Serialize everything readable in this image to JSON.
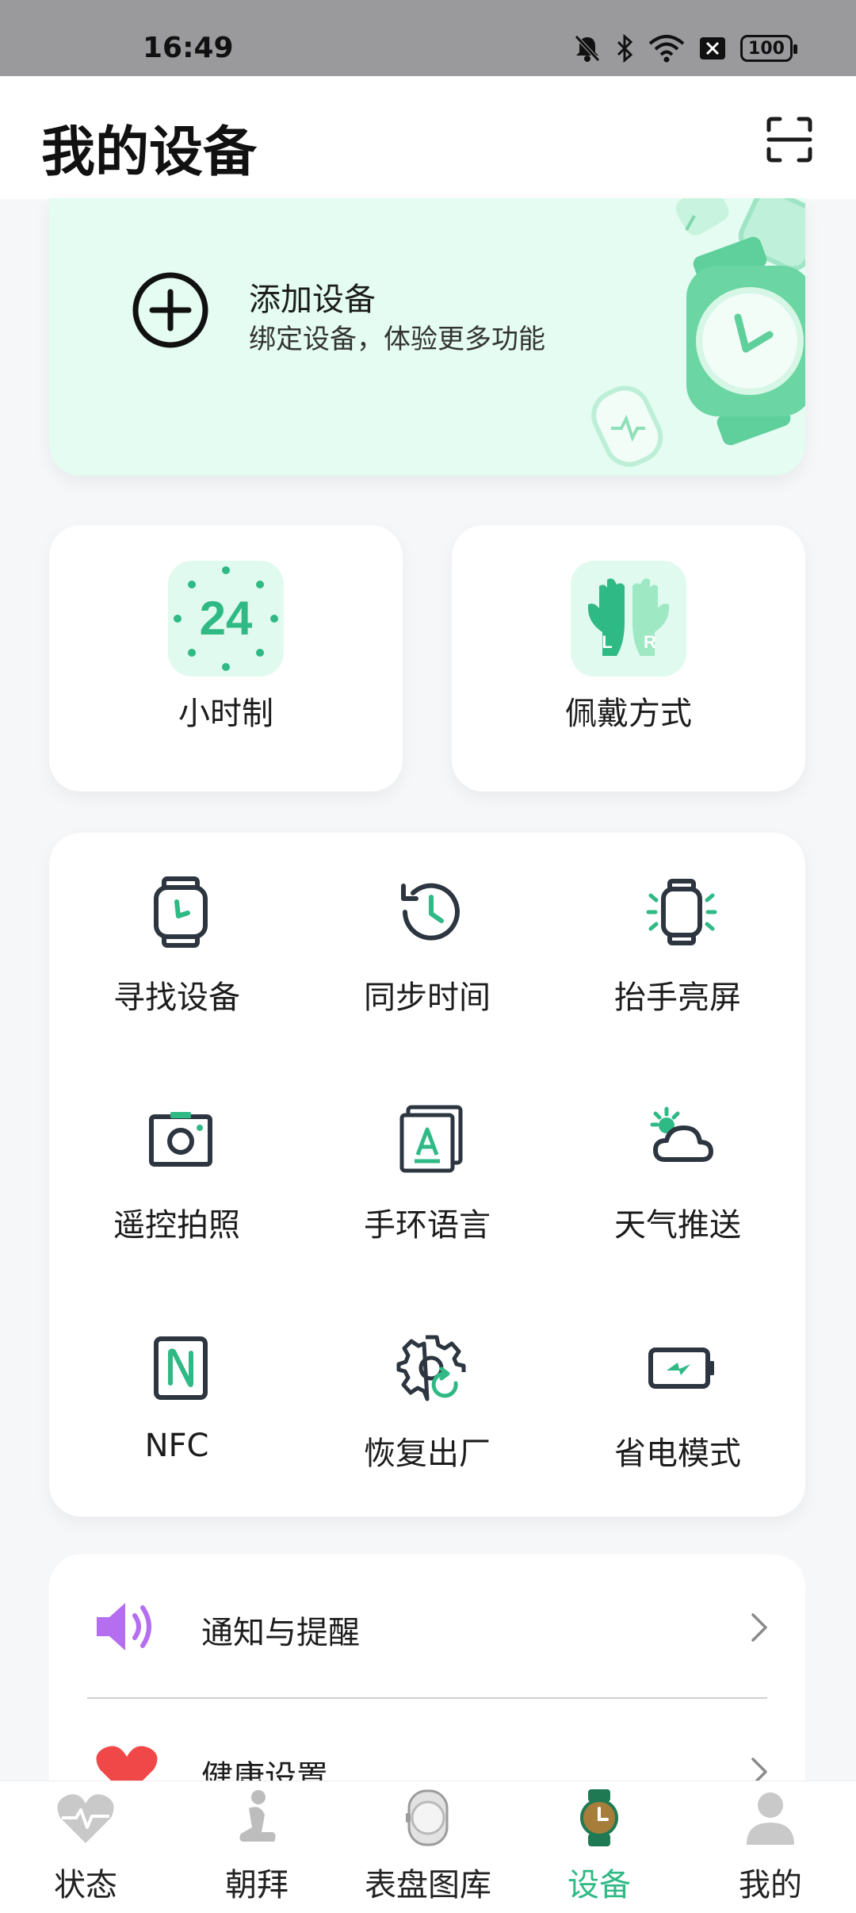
{
  "status_bar": {
    "time": "16:49",
    "battery": "100"
  },
  "header": {
    "title": "我的设备"
  },
  "add_device": {
    "title": "添加设备",
    "subtitle": "绑定设备，体验更多功能"
  },
  "quick_cards": [
    {
      "label": "小时制",
      "badge_text": "24"
    },
    {
      "label": "佩戴方式",
      "badge_left": "L",
      "badge_right": "R"
    }
  ],
  "features": [
    {
      "label": "寻找设备",
      "icon": "watch-find-icon"
    },
    {
      "label": "同步时间",
      "icon": "clock-sync-icon"
    },
    {
      "label": "抬手亮屏",
      "icon": "watch-wake-icon"
    },
    {
      "label": "遥控拍照",
      "icon": "camera-icon"
    },
    {
      "label": "手环语言",
      "icon": "language-icon"
    },
    {
      "label": "天气推送",
      "icon": "weather-icon"
    },
    {
      "label": "NFC",
      "icon": "nfc-icon"
    },
    {
      "label": "恢复出厂",
      "icon": "factory-reset-icon"
    },
    {
      "label": "省电模式",
      "icon": "battery-saver-icon"
    }
  ],
  "settings_list": [
    {
      "label": "通知与提醒",
      "icon": "speaker-icon"
    },
    {
      "label": "健康设置",
      "icon": "heart-icon"
    }
  ],
  "tabs": [
    {
      "label": "状态",
      "icon": "heart-rate-icon",
      "active": false
    },
    {
      "label": "朝拜",
      "icon": "prayer-icon",
      "active": false
    },
    {
      "label": "表盘图库",
      "icon": "watch-face-icon",
      "active": false
    },
    {
      "label": "设备",
      "icon": "device-watch-icon",
      "active": true
    },
    {
      "label": "我的",
      "icon": "profile-icon",
      "active": false
    }
  ],
  "colors": {
    "accent": "#2fb985",
    "card_green": "#e4fcf1",
    "icon_dark": "#2d3640"
  }
}
